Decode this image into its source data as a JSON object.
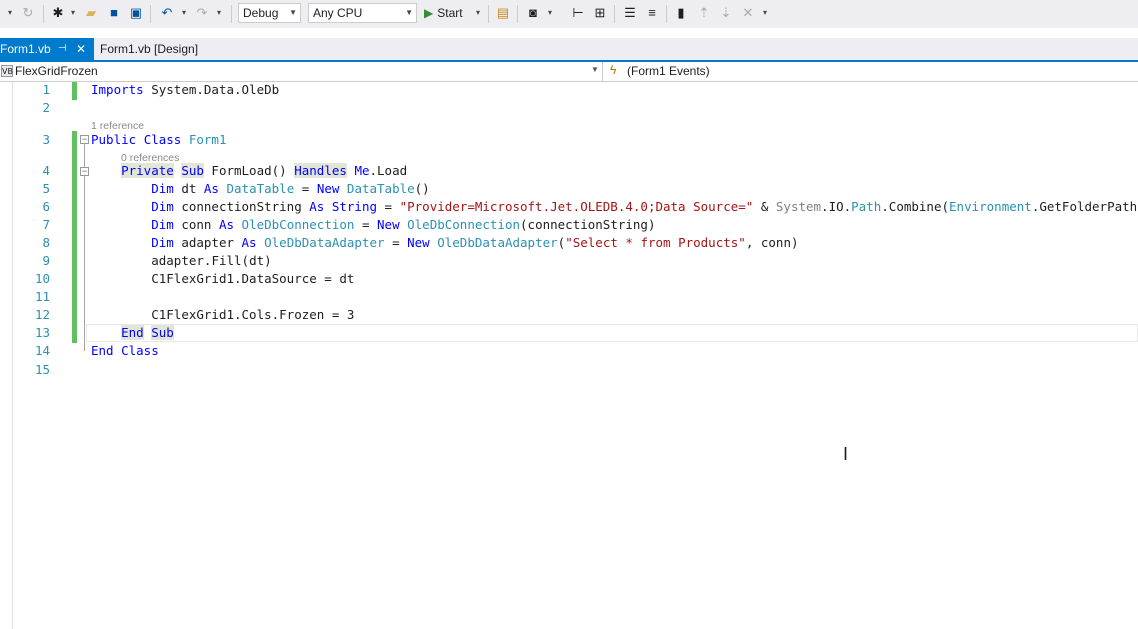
{
  "toolbar": {
    "config": "Debug",
    "platform": "Any CPU",
    "start": "Start"
  },
  "tabs": [
    {
      "label": "Form1.vb"
    },
    {
      "label": "Form1.vb [Design]"
    }
  ],
  "navbar": {
    "type_name": "FlexGridFrozen",
    "member_name": "(Form1 Events)",
    "lang_icon": "VB"
  },
  "editor": {
    "line_numbers": [
      "1",
      "2",
      "3",
      "4",
      "5",
      "6",
      "7",
      "8",
      "9",
      "10",
      "11",
      "12",
      "13",
      "14",
      "15"
    ],
    "lens_class": "1 reference",
    "lens_sub": "0 references",
    "lines": {
      "l1": {
        "a": "Imports",
        "b": " System.Data.OleDb"
      },
      "l3": {
        "a": "Public",
        "b": " ",
        "c": "Class",
        "d": " ",
        "e": "Form1"
      },
      "l4": {
        "a": "Private",
        "b": " ",
        "c": "Sub",
        "d": " FormLoad() ",
        "e": "Handles",
        "f": " ",
        "g": "Me",
        ".h": ".Load"
      },
      "l5": {
        "a": "Dim",
        "b": " dt ",
        "c": "As",
        "d": " ",
        "e": "DataTable",
        "f": " = ",
        "g": "New",
        "h": " ",
        "i": "DataTable",
        "j": "()"
      },
      "l6": {
        "a": "Dim",
        "b": " connectionString ",
        "c": "As",
        "d": " ",
        "e": "String",
        "f": " = ",
        "g": "\"Provider=Microsoft.Jet.OLEDB.4.0;Data Source=\"",
        "h": " & ",
        "i": "System",
        "j": ".IO.",
        "k": "Path",
        ".l": ".",
        "m": "Combine",
        "n": "(",
        "o": "Environment",
        "p": ".",
        "q": "GetFolderPath"
      },
      "l7": {
        "a": "Dim",
        "b": " conn ",
        "c": "As",
        "d": " ",
        "e": "OleDbConnection",
        "f": " = ",
        "g": "New",
        "h": " ",
        "i": "OleDbConnection",
        "j": "(connectionString)"
      },
      "l8": {
        "a": "Dim",
        "b": " adapter ",
        "c": "As",
        "d": " ",
        "e": "OleDbDataAdapter",
        "f": " = ",
        "g": "New",
        "h": " ",
        "i": "OleDbDataAdapter",
        "j": "(",
        "k": "\"Select * from Products\"",
        "l": ", conn)"
      },
      "l9": {
        "a": "adapter.",
        "b": "Fill",
        "c": "(dt)"
      },
      "l10": {
        "a": "C1FlexGrid1.DataSource = dt"
      },
      "l12": {
        "a": "C1FlexGrid1.Cols.Frozen = 3"
      },
      "l13": {
        "a": "End",
        "b": " ",
        "c": "Sub"
      },
      "l14": {
        "a": "End",
        "b": " ",
        "c": "Class"
      }
    }
  }
}
